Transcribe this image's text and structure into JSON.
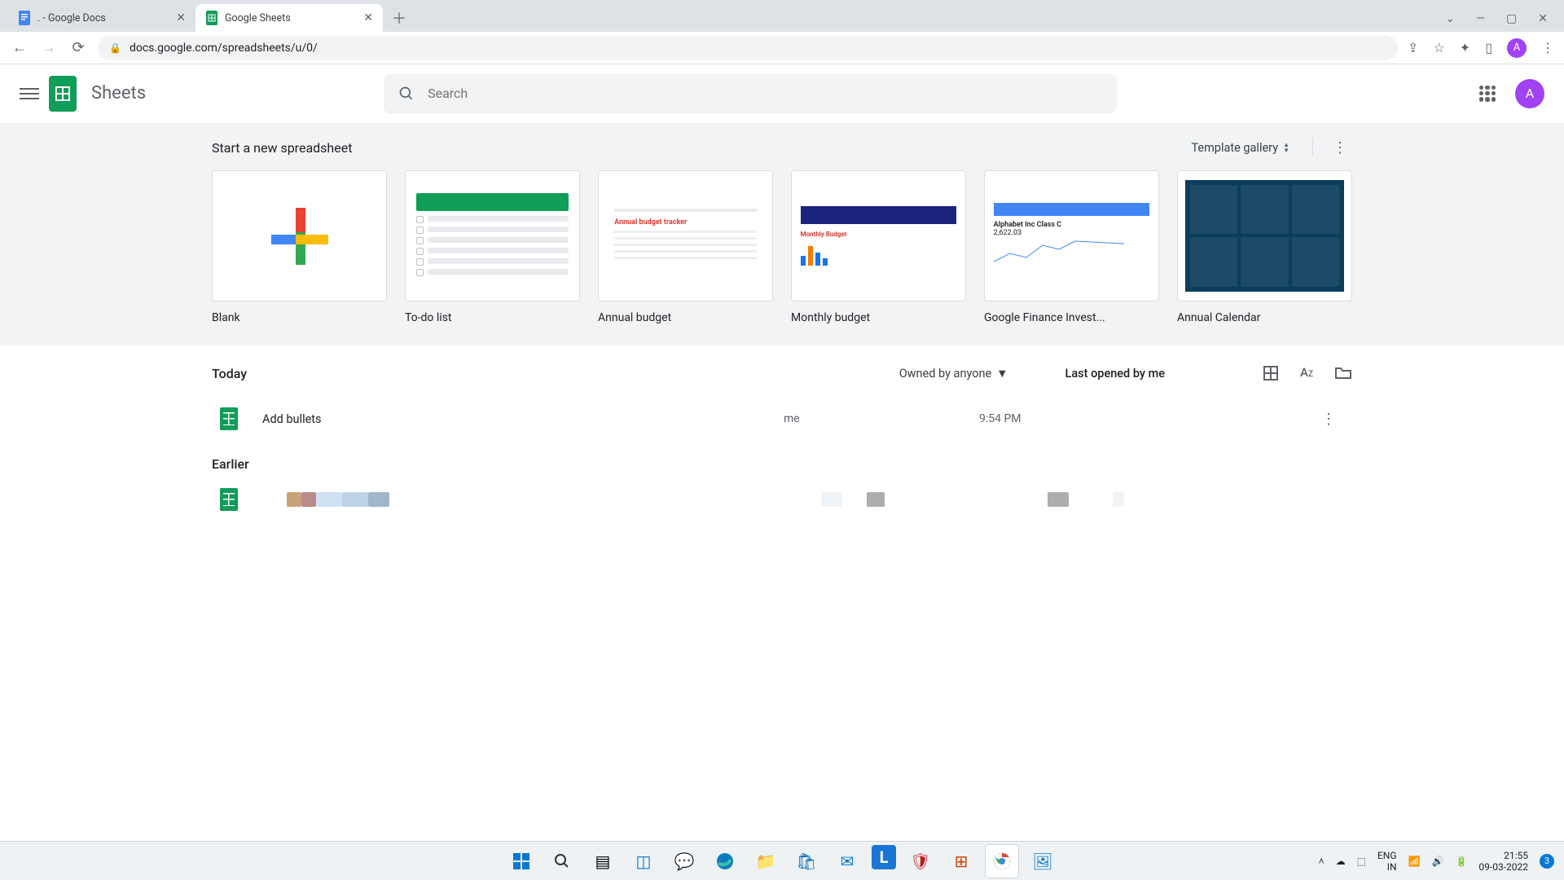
{
  "browser": {
    "tabs": [
      {
        "title": ". - Google Docs",
        "active": false
      },
      {
        "title": "Google Sheets",
        "active": true
      }
    ],
    "url": "docs.google.com/spreadsheets/u/0/",
    "avatar_letter": "A"
  },
  "app": {
    "title": "Sheets",
    "search_placeholder": "Search",
    "avatar_letter": "A"
  },
  "templates": {
    "heading": "Start a new spreadsheet",
    "gallery_label": "Template gallery",
    "items": [
      {
        "label": "Blank"
      },
      {
        "label": "To-do list"
      },
      {
        "label": "Annual budget"
      },
      {
        "label": "Monthly budget"
      },
      {
        "label": "Google Finance Invest..."
      },
      {
        "label": "Annual Calendar"
      }
    ],
    "finance_thumb": {
      "name": "Alphabet Inc Class C",
      "price": "2,622.03"
    },
    "annual_thumb_heading": "Annual budget tracker",
    "monthly_thumb_heading": "Monthly Budget"
  },
  "files": {
    "section_today": "Today",
    "section_earlier": "Earlier",
    "owned_by_label": "Owned by anyone",
    "last_opened_label": "Last opened by me",
    "rows": [
      {
        "name": "Add bullets",
        "owner": "me",
        "time": "9:54 PM"
      }
    ]
  },
  "taskbar": {
    "lang_top": "ENG",
    "lang_bottom": "IN",
    "time": "21:55",
    "date": "09-03-2022",
    "notif_count": "3"
  }
}
